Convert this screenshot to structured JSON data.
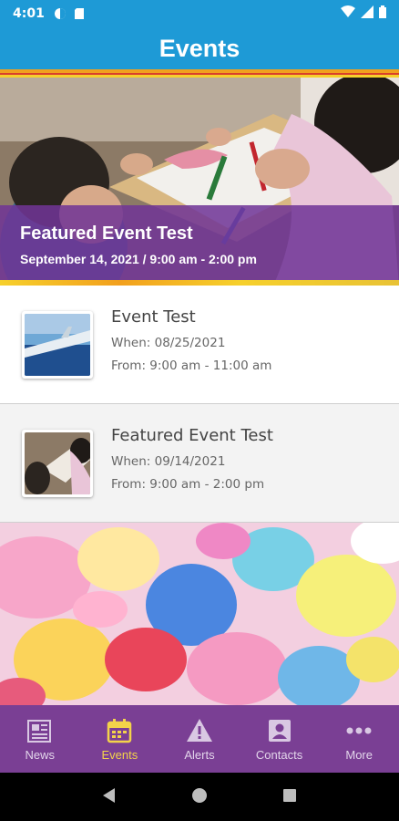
{
  "status_bar": {
    "time": "4:01"
  },
  "header": {
    "title": "Events"
  },
  "featured": {
    "title": "Featured Event Test",
    "datetime": "September 14, 2021 / 9:00 am - 2:00 pm"
  },
  "events": [
    {
      "name": "Event Test",
      "when": "When: 08/25/2021",
      "from": "From: 9:00 am - 11:00 am"
    },
    {
      "name": "Featured Event Test",
      "when": "When: 09/14/2021",
      "from": "From: 9:00 am - 2:00 pm"
    }
  ],
  "tabs": [
    {
      "label": "News",
      "icon": "newspaper-icon",
      "active": false
    },
    {
      "label": "Events",
      "icon": "calendar-icon",
      "active": true
    },
    {
      "label": "Alerts",
      "icon": "warning-icon",
      "active": false
    },
    {
      "label": "Contacts",
      "icon": "contact-card-icon",
      "active": false
    },
    {
      "label": "More",
      "icon": "more-dots-icon",
      "active": false
    }
  ],
  "colors": {
    "header": "#1e9ad6",
    "tab_bar": "#7a3f94",
    "tab_active": "#f3d34a",
    "overlay": "#703496"
  }
}
